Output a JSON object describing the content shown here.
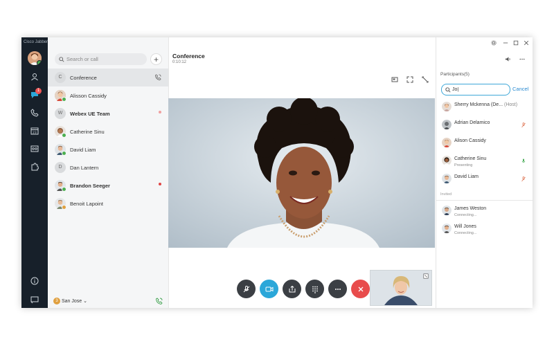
{
  "app": {
    "title": "Cisco Jabber"
  },
  "rail": {
    "chat_badge": "1",
    "icons": [
      "contacts-icon",
      "chat-icon",
      "phone-icon",
      "calendar-icon",
      "voicemail-icon",
      "custom-tab-icon",
      "info-icon",
      "screen-icon"
    ]
  },
  "contacts": {
    "search_placeholder": "Search or call",
    "items": [
      {
        "name": "Conference",
        "initial": "C",
        "bold": false
      },
      {
        "name": "Alisson Cassidy",
        "bold": false
      },
      {
        "name": "Webex UE Team",
        "initial": "W",
        "bold": true
      },
      {
        "name": "Catherine Sinu",
        "bold": false
      },
      {
        "name": "David Liam",
        "bold": false
      },
      {
        "name": "Dan Lantern",
        "initial": "D",
        "bold": false
      },
      {
        "name": "Brandon Seeger",
        "bold": true
      },
      {
        "name": "Benoit Lapoint",
        "bold": false
      }
    ],
    "footer": {
      "location": "San Jose",
      "location_initial": "3"
    }
  },
  "conference": {
    "title": "Conference",
    "time": "0:10:12"
  },
  "participants": {
    "title": "Participants(5)",
    "search_value": "Jo|",
    "cancel_label": "Cancel",
    "list": [
      {
        "name": "Sherry Mckenna (De...",
        "tag": "(Host)",
        "sub": ""
      },
      {
        "name": "Adrian Delamico",
        "tag": "",
        "sub": ""
      },
      {
        "name": "Alison Cassidy",
        "tag": "",
        "sub": ""
      },
      {
        "name": "Catherine Sinu",
        "tag": "",
        "sub": "Presenting"
      },
      {
        "name": "David Liam",
        "tag": "",
        "sub": ""
      }
    ],
    "invited_label": "Invited",
    "invited": [
      {
        "name": "James Weston",
        "sub": "Connecting..."
      },
      {
        "name": "Will Jones",
        "sub": "Connecting..."
      }
    ]
  },
  "colors": {
    "rail_bg": "#17202a",
    "accent": "#2a8ad0",
    "video_button": "#2ba7d9",
    "end_call": "#e84c4c",
    "dark_button": "#3b3f44"
  }
}
